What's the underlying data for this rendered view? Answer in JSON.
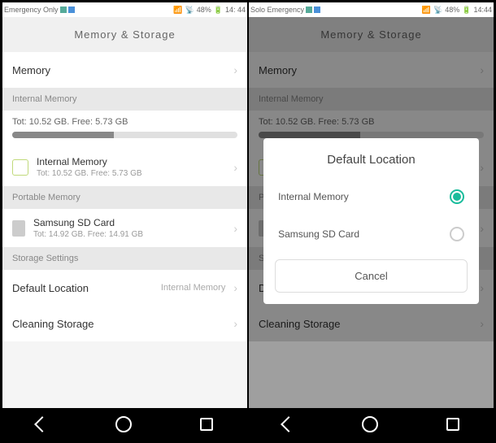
{
  "status": {
    "left_carrier": "Emergency Only",
    "right_carrier": "Solo Emergency",
    "battery": "48%",
    "time_left": "14: 44",
    "time_right": "14:44"
  },
  "header": "Memory & Storage",
  "memory_row": "Memory",
  "sections": {
    "internal": "Internal Memory",
    "portable": "Portable Memory",
    "storage_settings": "Storage Settings"
  },
  "storage_summary": "Tot: 10.52 GB. Free: 5.73 GB",
  "items": {
    "internal": {
      "title": "Internal Memory",
      "sub": "Tot: 10.52 GB. Free: 5.73 GB"
    },
    "sd": {
      "title": "Samsung SD Card",
      "sub": "Tot: 14.92 GB. Free: 14.91 GB"
    }
  },
  "settings": {
    "default_location": {
      "label": "Default Location",
      "value": "Internal Memory"
    },
    "cleaning": "Cleaning Storage"
  },
  "dialog": {
    "title": "Default Location",
    "option1": "Internal Memory",
    "option2": "Samsung SD Card",
    "cancel": "Cancel"
  }
}
